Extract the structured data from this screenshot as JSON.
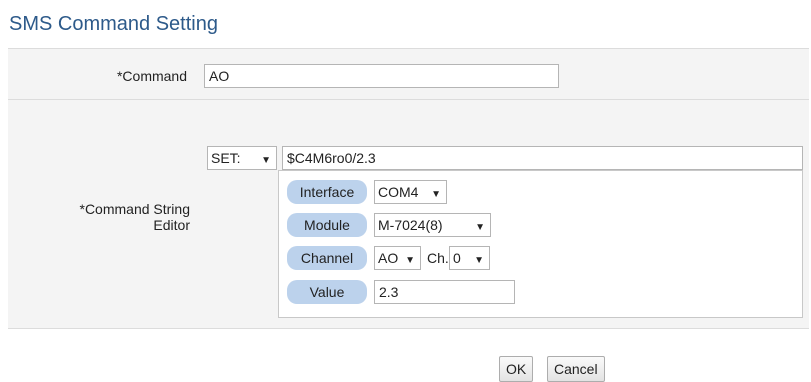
{
  "page": {
    "title": "SMS Command Setting"
  },
  "command": {
    "label": "*Command",
    "value": "AO"
  },
  "editor": {
    "label_line1": "*Command String",
    "label_line2": "Editor",
    "mode": "SET:",
    "command_string": "$C4M6ro0/2.3",
    "interface": {
      "label": "Interface",
      "value": "COM4"
    },
    "module": {
      "label": "Module",
      "value": "M-7024(8)"
    },
    "channel": {
      "label": "Channel",
      "type_value": "AO",
      "ch_label": "Ch.",
      "ch_value": "0"
    },
    "value": {
      "label": "Value",
      "value": "2.3"
    }
  },
  "buttons": {
    "ok": "OK",
    "cancel": "Cancel"
  },
  "colors": {
    "title": "#2d5a8a",
    "pill": "#bcd2ec",
    "row_bg": "#f4f4f4"
  },
  "icons": {
    "dropdown": "triangle-down"
  }
}
